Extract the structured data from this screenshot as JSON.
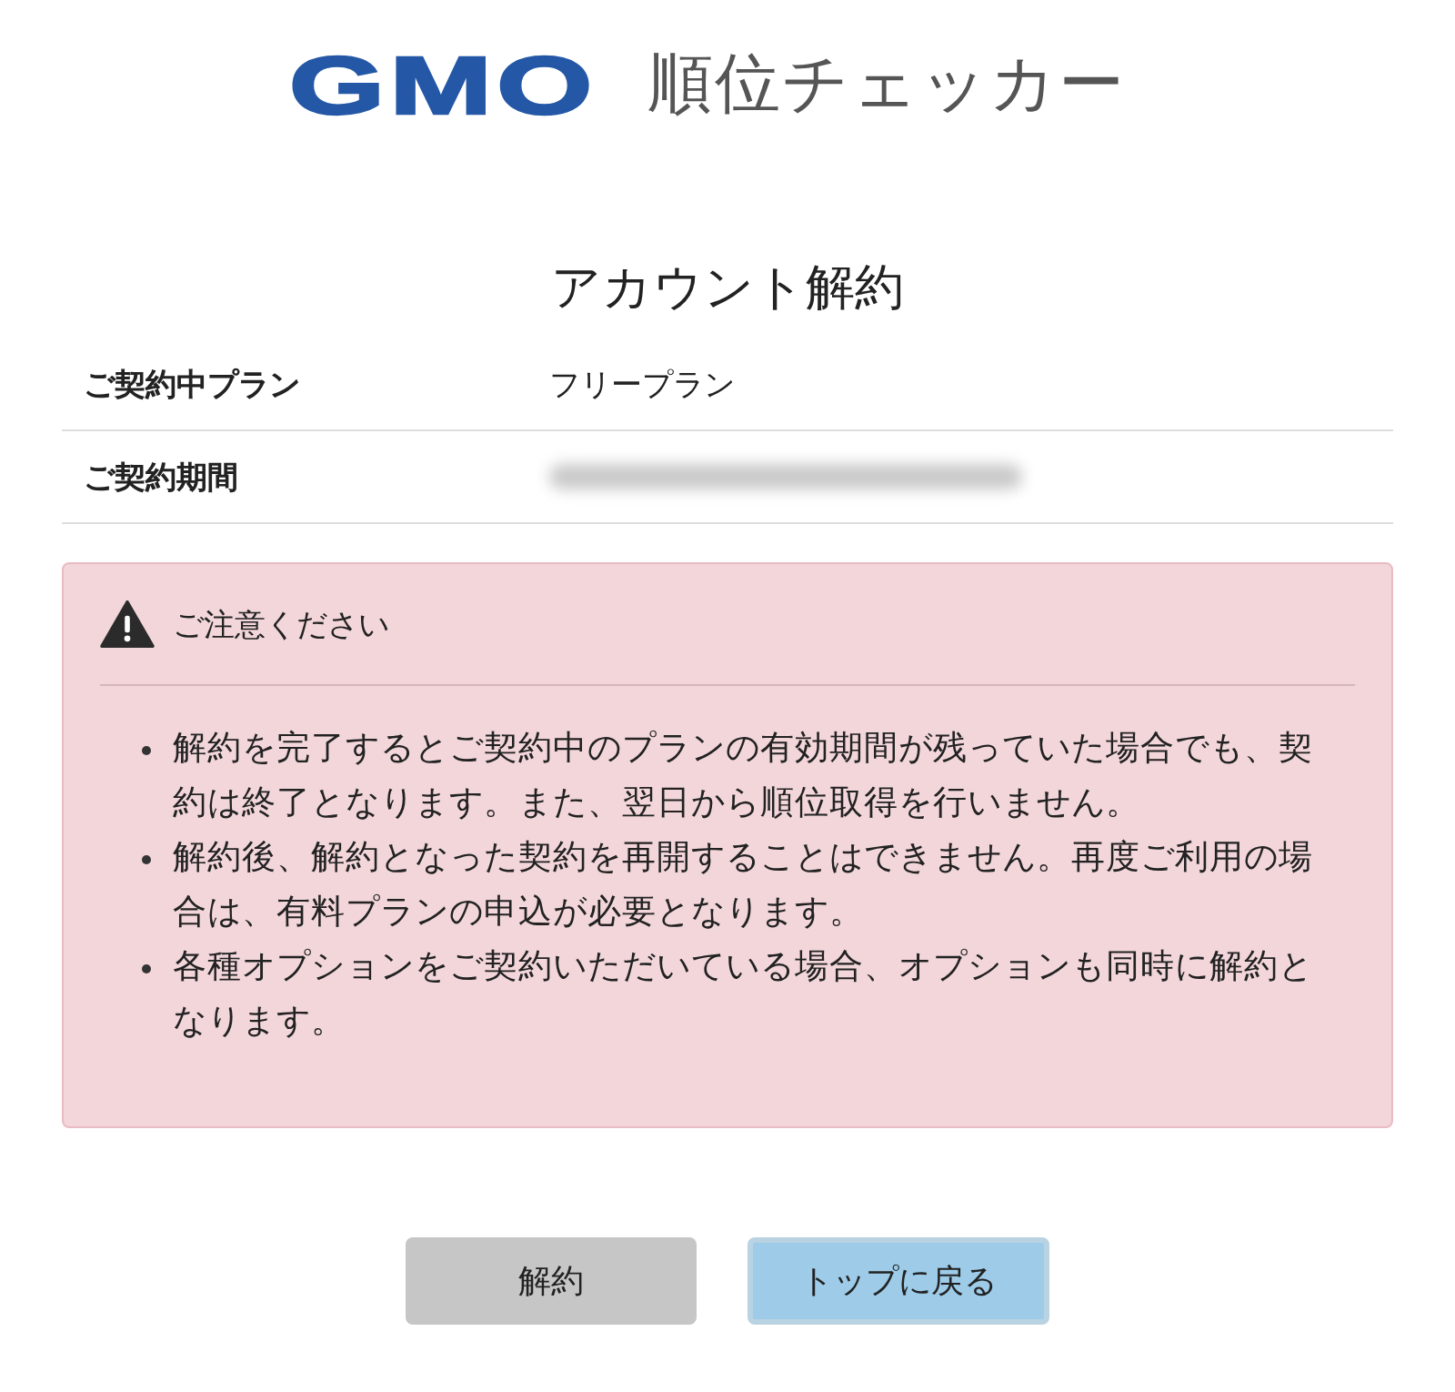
{
  "logo": {
    "brand": "GMO",
    "product": "順位チェッカー"
  },
  "title": "アカウント解約",
  "details": [
    {
      "label": "ご契約中プラン",
      "value": "フリープラン",
      "redacted": false
    },
    {
      "label": "ご契約期間",
      "redacted": true
    }
  ],
  "notice": {
    "heading": "ご注意ください",
    "items": [
      "解約を完了するとご契約中のプランの有効期間が残っていた場合でも、契約は終了となります。また、翌日から順位取得を行いません。",
      "解約後、解約となった契約を再開することはできません。再度ご利用の場合は、有料プランの申込が必要となります。",
      "各種オプションをご契約いただいている場合、オプションも同時に解約となります。"
    ]
  },
  "buttons": [
    {
      "label": "解約",
      "kind": "secondary",
      "focused": false
    },
    {
      "label": "トップに戻る",
      "kind": "primary",
      "focused": true
    }
  ]
}
